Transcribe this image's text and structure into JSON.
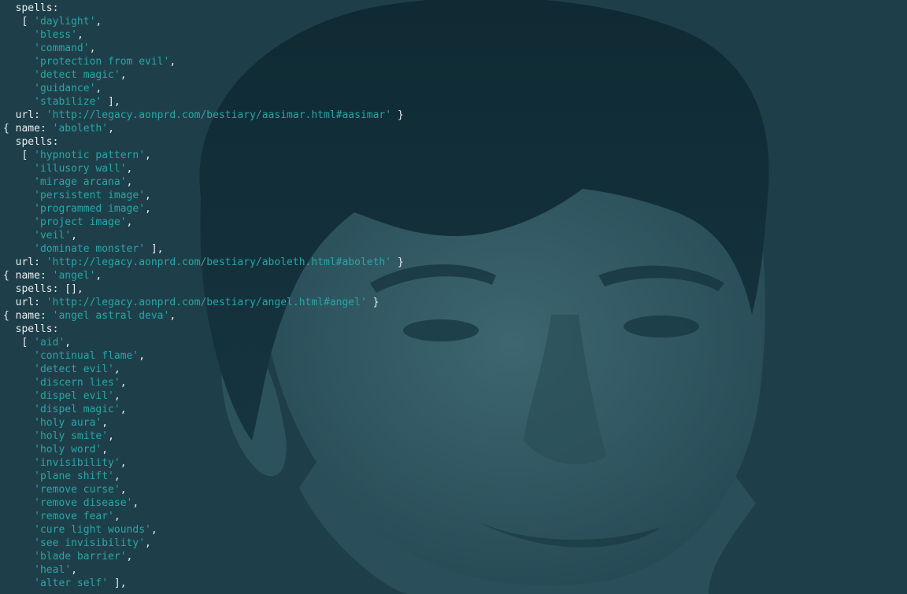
{
  "theme": {
    "background": "#1e3f4a",
    "text_color": "#e8eef0",
    "string_color": "#28a6a6"
  },
  "background_image": {
    "description": "portrait",
    "icon": "portrait-image"
  },
  "lines": [
    [
      {
        "t": "  spells:",
        "k": "p"
      }
    ],
    [
      {
        "t": "   [ ",
        "k": "p"
      },
      {
        "t": "'daylight'",
        "k": "s"
      },
      {
        "t": ",",
        "k": "p"
      }
    ],
    [
      {
        "t": "     ",
        "k": "p"
      },
      {
        "t": "'bless'",
        "k": "s"
      },
      {
        "t": ",",
        "k": "p"
      }
    ],
    [
      {
        "t": "     ",
        "k": "p"
      },
      {
        "t": "'command'",
        "k": "s"
      },
      {
        "t": ",",
        "k": "p"
      }
    ],
    [
      {
        "t": "     ",
        "k": "p"
      },
      {
        "t": "'protection from evil'",
        "k": "s"
      },
      {
        "t": ",",
        "k": "p"
      }
    ],
    [
      {
        "t": "     ",
        "k": "p"
      },
      {
        "t": "'detect magic'",
        "k": "s"
      },
      {
        "t": ",",
        "k": "p"
      }
    ],
    [
      {
        "t": "     ",
        "k": "p"
      },
      {
        "t": "'guidance'",
        "k": "s"
      },
      {
        "t": ",",
        "k": "p"
      }
    ],
    [
      {
        "t": "     ",
        "k": "p"
      },
      {
        "t": "'stabilize'",
        "k": "s"
      },
      {
        "t": " ],",
        "k": "p"
      }
    ],
    [
      {
        "t": "  url: ",
        "k": "p"
      },
      {
        "t": "'http://legacy.aonprd.com/bestiary/aasimar.html#aasimar'",
        "k": "s"
      },
      {
        "t": " }",
        "k": "p"
      }
    ],
    [
      {
        "t": "{ name: ",
        "k": "p"
      },
      {
        "t": "'aboleth'",
        "k": "s"
      },
      {
        "t": ",",
        "k": "p"
      }
    ],
    [
      {
        "t": "  spells:",
        "k": "p"
      }
    ],
    [
      {
        "t": "   [ ",
        "k": "p"
      },
      {
        "t": "'hypnotic pattern'",
        "k": "s"
      },
      {
        "t": ",",
        "k": "p"
      }
    ],
    [
      {
        "t": "     ",
        "k": "p"
      },
      {
        "t": "'illusory wall'",
        "k": "s"
      },
      {
        "t": ",",
        "k": "p"
      }
    ],
    [
      {
        "t": "     ",
        "k": "p"
      },
      {
        "t": "'mirage arcana'",
        "k": "s"
      },
      {
        "t": ",",
        "k": "p"
      }
    ],
    [
      {
        "t": "     ",
        "k": "p"
      },
      {
        "t": "'persistent image'",
        "k": "s"
      },
      {
        "t": ",",
        "k": "p"
      }
    ],
    [
      {
        "t": "     ",
        "k": "p"
      },
      {
        "t": "'programmed image'",
        "k": "s"
      },
      {
        "t": ",",
        "k": "p"
      }
    ],
    [
      {
        "t": "     ",
        "k": "p"
      },
      {
        "t": "'project image'",
        "k": "s"
      },
      {
        "t": ",",
        "k": "p"
      }
    ],
    [
      {
        "t": "     ",
        "k": "p"
      },
      {
        "t": "'veil'",
        "k": "s"
      },
      {
        "t": ",",
        "k": "p"
      }
    ],
    [
      {
        "t": "     ",
        "k": "p"
      },
      {
        "t": "'dominate monster'",
        "k": "s"
      },
      {
        "t": " ],",
        "k": "p"
      }
    ],
    [
      {
        "t": "  url: ",
        "k": "p"
      },
      {
        "t": "'http://legacy.aonprd.com/bestiary/aboleth.html#aboleth'",
        "k": "s"
      },
      {
        "t": " }",
        "k": "p"
      }
    ],
    [
      {
        "t": "{ name: ",
        "k": "p"
      },
      {
        "t": "'angel'",
        "k": "s"
      },
      {
        "t": ",",
        "k": "p"
      }
    ],
    [
      {
        "t": "  spells: [],",
        "k": "p"
      }
    ],
    [
      {
        "t": "  url: ",
        "k": "p"
      },
      {
        "t": "'http://legacy.aonprd.com/bestiary/angel.html#angel'",
        "k": "s"
      },
      {
        "t": " }",
        "k": "p"
      }
    ],
    [
      {
        "t": "{ name: ",
        "k": "p"
      },
      {
        "t": "'angel astral deva'",
        "k": "s"
      },
      {
        "t": ",",
        "k": "p"
      }
    ],
    [
      {
        "t": "  spells:",
        "k": "p"
      }
    ],
    [
      {
        "t": "   [ ",
        "k": "p"
      },
      {
        "t": "'aid'",
        "k": "s"
      },
      {
        "t": ",",
        "k": "p"
      }
    ],
    [
      {
        "t": "     ",
        "k": "p"
      },
      {
        "t": "'continual flame'",
        "k": "s"
      },
      {
        "t": ",",
        "k": "p"
      }
    ],
    [
      {
        "t": "     ",
        "k": "p"
      },
      {
        "t": "'detect evil'",
        "k": "s"
      },
      {
        "t": ",",
        "k": "p"
      }
    ],
    [
      {
        "t": "     ",
        "k": "p"
      },
      {
        "t": "'discern lies'",
        "k": "s"
      },
      {
        "t": ",",
        "k": "p"
      }
    ],
    [
      {
        "t": "     ",
        "k": "p"
      },
      {
        "t": "'dispel evil'",
        "k": "s"
      },
      {
        "t": ",",
        "k": "p"
      }
    ],
    [
      {
        "t": "     ",
        "k": "p"
      },
      {
        "t": "'dispel magic'",
        "k": "s"
      },
      {
        "t": ",",
        "k": "p"
      }
    ],
    [
      {
        "t": "     ",
        "k": "p"
      },
      {
        "t": "'holy aura'",
        "k": "s"
      },
      {
        "t": ",",
        "k": "p"
      }
    ],
    [
      {
        "t": "     ",
        "k": "p"
      },
      {
        "t": "'holy smite'",
        "k": "s"
      },
      {
        "t": ",",
        "k": "p"
      }
    ],
    [
      {
        "t": "     ",
        "k": "p"
      },
      {
        "t": "'holy word'",
        "k": "s"
      },
      {
        "t": ",",
        "k": "p"
      }
    ],
    [
      {
        "t": "     ",
        "k": "p"
      },
      {
        "t": "'invisibility'",
        "k": "s"
      },
      {
        "t": ",",
        "k": "p"
      }
    ],
    [
      {
        "t": "     ",
        "k": "p"
      },
      {
        "t": "'plane shift'",
        "k": "s"
      },
      {
        "t": ",",
        "k": "p"
      }
    ],
    [
      {
        "t": "     ",
        "k": "p"
      },
      {
        "t": "'remove curse'",
        "k": "s"
      },
      {
        "t": ",",
        "k": "p"
      }
    ],
    [
      {
        "t": "     ",
        "k": "p"
      },
      {
        "t": "'remove disease'",
        "k": "s"
      },
      {
        "t": ",",
        "k": "p"
      }
    ],
    [
      {
        "t": "     ",
        "k": "p"
      },
      {
        "t": "'remove fear'",
        "k": "s"
      },
      {
        "t": ",",
        "k": "p"
      }
    ],
    [
      {
        "t": "     ",
        "k": "p"
      },
      {
        "t": "'cure light wounds'",
        "k": "s"
      },
      {
        "t": ",",
        "k": "p"
      }
    ],
    [
      {
        "t": "     ",
        "k": "p"
      },
      {
        "t": "'see invisibility'",
        "k": "s"
      },
      {
        "t": ",",
        "k": "p"
      }
    ],
    [
      {
        "t": "     ",
        "k": "p"
      },
      {
        "t": "'blade barrier'",
        "k": "s"
      },
      {
        "t": ",",
        "k": "p"
      }
    ],
    [
      {
        "t": "     ",
        "k": "p"
      },
      {
        "t": "'heal'",
        "k": "s"
      },
      {
        "t": ",",
        "k": "p"
      }
    ],
    [
      {
        "t": "     ",
        "k": "p"
      },
      {
        "t": "'alter self'",
        "k": "s"
      },
      {
        "t": " ],",
        "k": "p"
      }
    ]
  ]
}
